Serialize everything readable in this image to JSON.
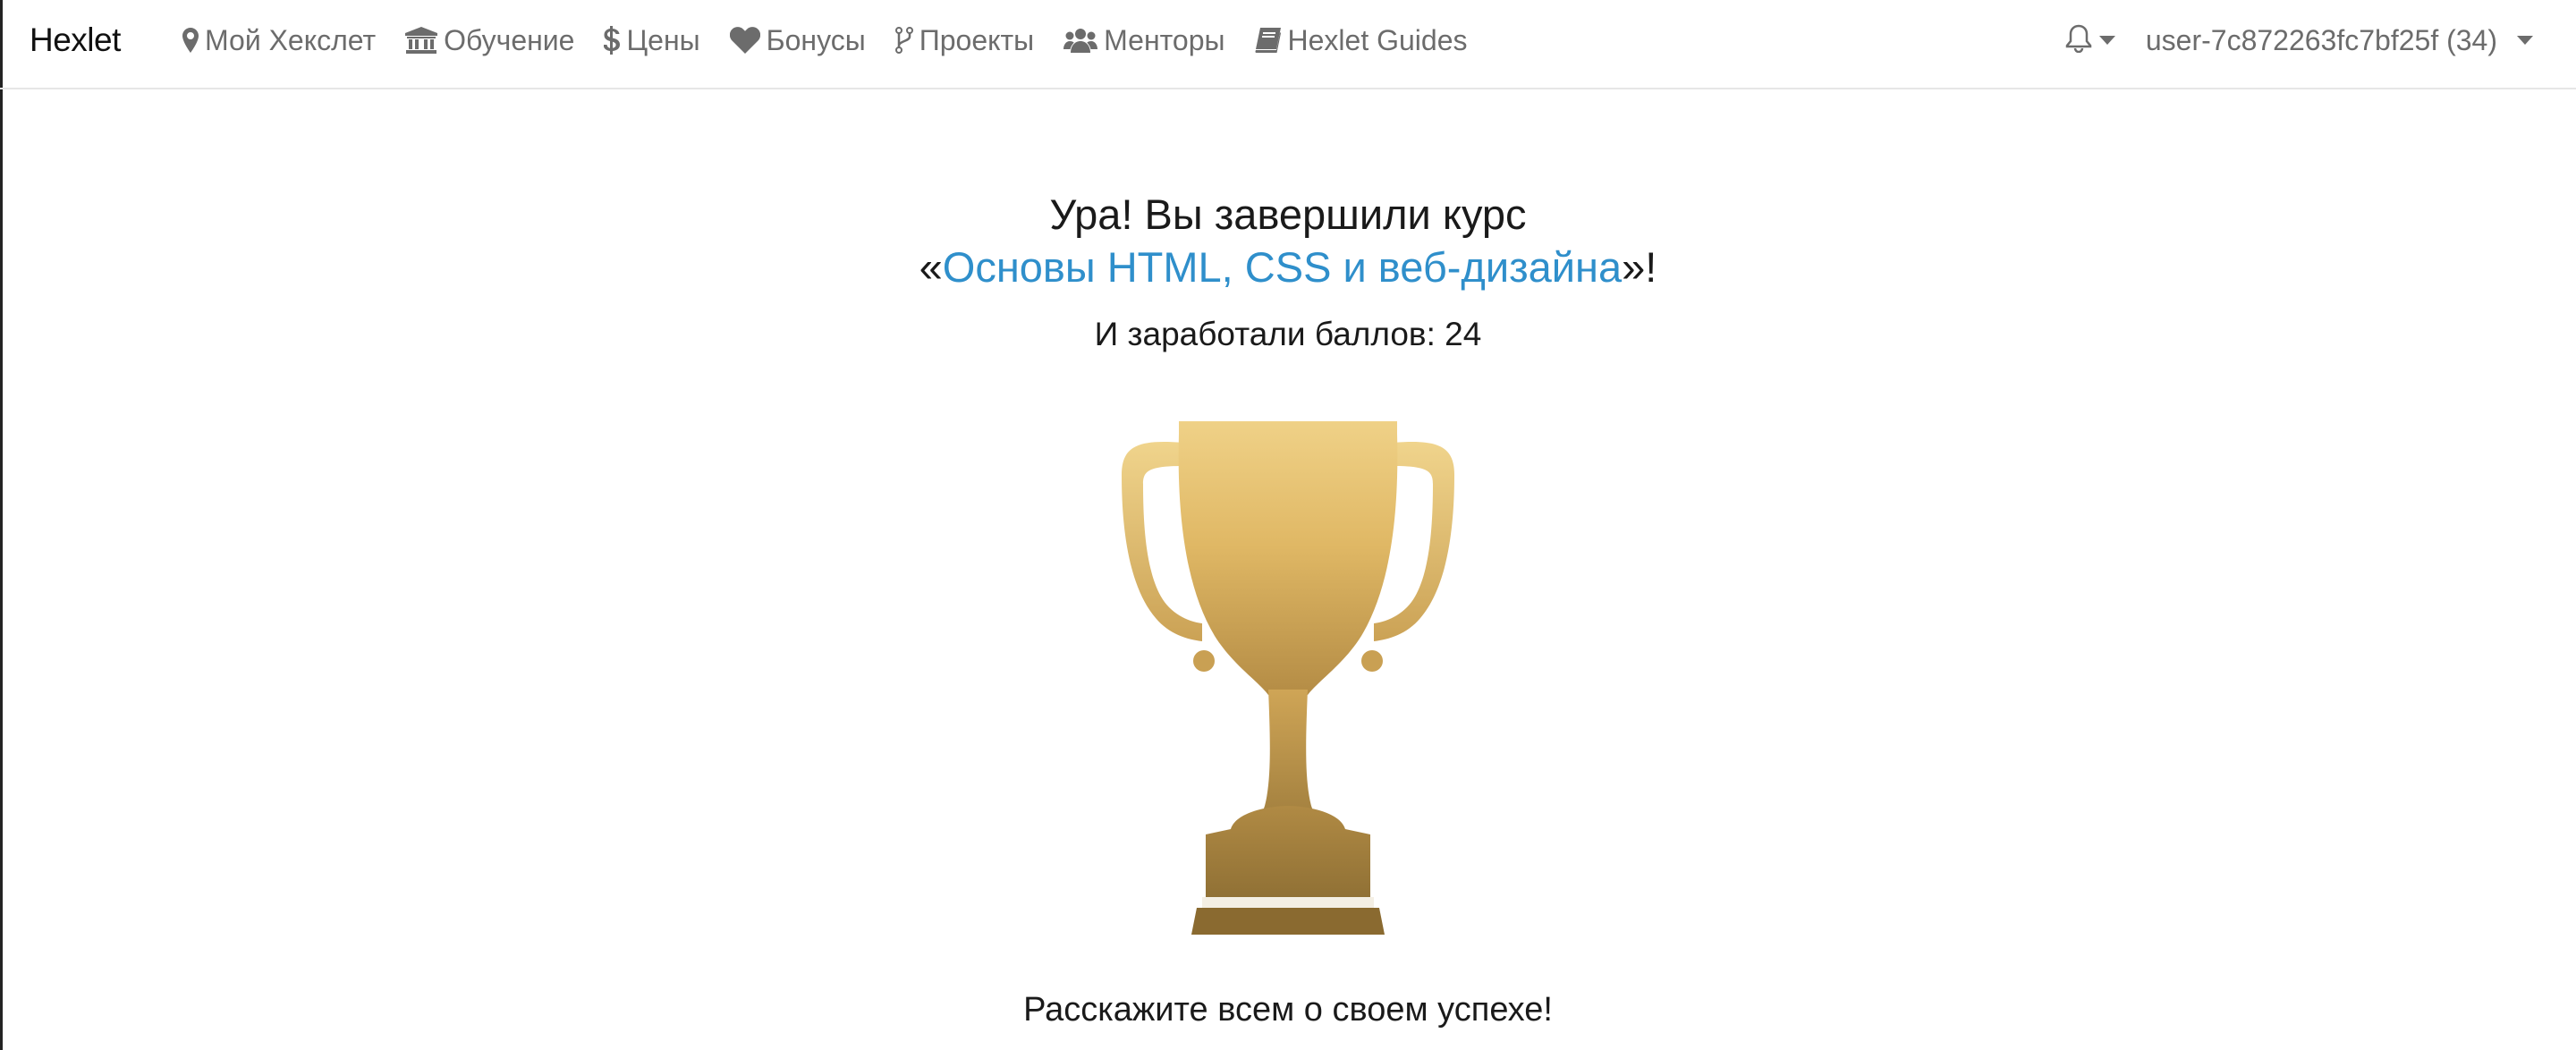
{
  "navbar": {
    "brand": "Hexlet",
    "items": [
      {
        "label": "Мой Хекслет",
        "icon": "map-marker-icon"
      },
      {
        "label": "Обучение",
        "icon": "university-icon"
      },
      {
        "label": "Цены",
        "icon": "dollar-icon"
      },
      {
        "label": "Бонусы",
        "icon": "heart-icon"
      },
      {
        "label": "Проекты",
        "icon": "code-fork-icon"
      },
      {
        "label": "Менторы",
        "icon": "users-icon"
      },
      {
        "label": "Hexlet Guides",
        "icon": "book-icon"
      }
    ],
    "notifications_icon": "bell-icon",
    "user_label": "user-7c872263fc7bf25f (34)"
  },
  "main": {
    "title_line1": "Ура! Вы завершили курс",
    "quote_open": "«",
    "course_name": "Основы HTML, CSS и веб-дизайна",
    "quote_close": "»!",
    "points_text": "И заработали баллов: 24",
    "trophy_icon": "trophy-icon",
    "share_prompt": "Расскажите всем о своем успехе!"
  },
  "colors": {
    "link": "#2f8fcb",
    "nav_text": "#6c6c6c",
    "trophy_gold_light": "#ecc97a",
    "trophy_gold_dark": "#9a7a3a"
  }
}
